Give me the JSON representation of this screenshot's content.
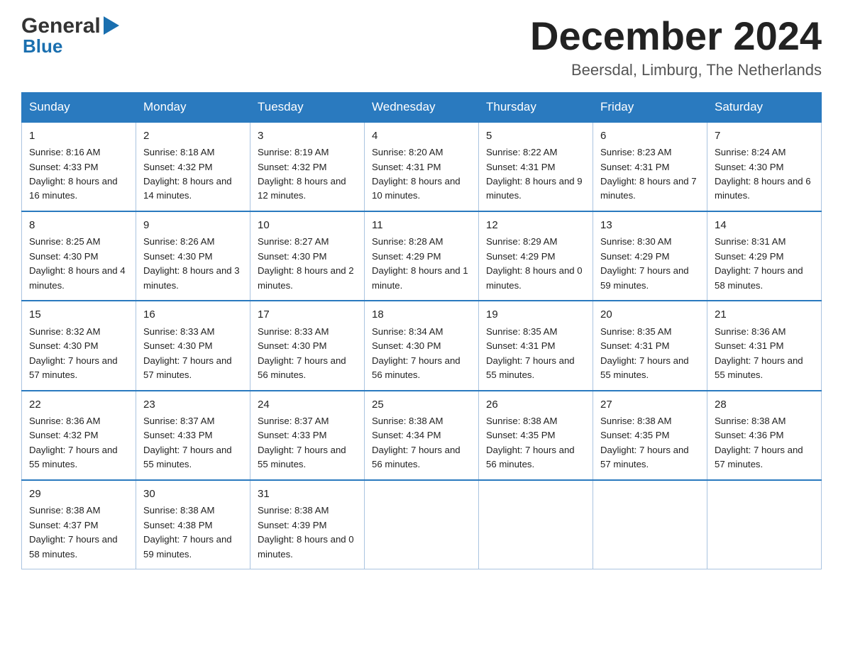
{
  "header": {
    "logo_general": "General",
    "logo_blue": "Blue",
    "month_title": "December 2024",
    "location": "Beersdal, Limburg, The Netherlands"
  },
  "days_of_week": [
    "Sunday",
    "Monday",
    "Tuesday",
    "Wednesday",
    "Thursday",
    "Friday",
    "Saturday"
  ],
  "weeks": [
    [
      {
        "day": "1",
        "sunrise": "8:16 AM",
        "sunset": "4:33 PM",
        "daylight": "8 hours and 16 minutes."
      },
      {
        "day": "2",
        "sunrise": "8:18 AM",
        "sunset": "4:32 PM",
        "daylight": "8 hours and 14 minutes."
      },
      {
        "day": "3",
        "sunrise": "8:19 AM",
        "sunset": "4:32 PM",
        "daylight": "8 hours and 12 minutes."
      },
      {
        "day": "4",
        "sunrise": "8:20 AM",
        "sunset": "4:31 PM",
        "daylight": "8 hours and 10 minutes."
      },
      {
        "day": "5",
        "sunrise": "8:22 AM",
        "sunset": "4:31 PM",
        "daylight": "8 hours and 9 minutes."
      },
      {
        "day": "6",
        "sunrise": "8:23 AM",
        "sunset": "4:31 PM",
        "daylight": "8 hours and 7 minutes."
      },
      {
        "day": "7",
        "sunrise": "8:24 AM",
        "sunset": "4:30 PM",
        "daylight": "8 hours and 6 minutes."
      }
    ],
    [
      {
        "day": "8",
        "sunrise": "8:25 AM",
        "sunset": "4:30 PM",
        "daylight": "8 hours and 4 minutes."
      },
      {
        "day": "9",
        "sunrise": "8:26 AM",
        "sunset": "4:30 PM",
        "daylight": "8 hours and 3 minutes."
      },
      {
        "day": "10",
        "sunrise": "8:27 AM",
        "sunset": "4:30 PM",
        "daylight": "8 hours and 2 minutes."
      },
      {
        "day": "11",
        "sunrise": "8:28 AM",
        "sunset": "4:29 PM",
        "daylight": "8 hours and 1 minute."
      },
      {
        "day": "12",
        "sunrise": "8:29 AM",
        "sunset": "4:29 PM",
        "daylight": "8 hours and 0 minutes."
      },
      {
        "day": "13",
        "sunrise": "8:30 AM",
        "sunset": "4:29 PM",
        "daylight": "7 hours and 59 minutes."
      },
      {
        "day": "14",
        "sunrise": "8:31 AM",
        "sunset": "4:29 PM",
        "daylight": "7 hours and 58 minutes."
      }
    ],
    [
      {
        "day": "15",
        "sunrise": "8:32 AM",
        "sunset": "4:30 PM",
        "daylight": "7 hours and 57 minutes."
      },
      {
        "day": "16",
        "sunrise": "8:33 AM",
        "sunset": "4:30 PM",
        "daylight": "7 hours and 57 minutes."
      },
      {
        "day": "17",
        "sunrise": "8:33 AM",
        "sunset": "4:30 PM",
        "daylight": "7 hours and 56 minutes."
      },
      {
        "day": "18",
        "sunrise": "8:34 AM",
        "sunset": "4:30 PM",
        "daylight": "7 hours and 56 minutes."
      },
      {
        "day": "19",
        "sunrise": "8:35 AM",
        "sunset": "4:31 PM",
        "daylight": "7 hours and 55 minutes."
      },
      {
        "day": "20",
        "sunrise": "8:35 AM",
        "sunset": "4:31 PM",
        "daylight": "7 hours and 55 minutes."
      },
      {
        "day": "21",
        "sunrise": "8:36 AM",
        "sunset": "4:31 PM",
        "daylight": "7 hours and 55 minutes."
      }
    ],
    [
      {
        "day": "22",
        "sunrise": "8:36 AM",
        "sunset": "4:32 PM",
        "daylight": "7 hours and 55 minutes."
      },
      {
        "day": "23",
        "sunrise": "8:37 AM",
        "sunset": "4:33 PM",
        "daylight": "7 hours and 55 minutes."
      },
      {
        "day": "24",
        "sunrise": "8:37 AM",
        "sunset": "4:33 PM",
        "daylight": "7 hours and 55 minutes."
      },
      {
        "day": "25",
        "sunrise": "8:38 AM",
        "sunset": "4:34 PM",
        "daylight": "7 hours and 56 minutes."
      },
      {
        "day": "26",
        "sunrise": "8:38 AM",
        "sunset": "4:35 PM",
        "daylight": "7 hours and 56 minutes."
      },
      {
        "day": "27",
        "sunrise": "8:38 AM",
        "sunset": "4:35 PM",
        "daylight": "7 hours and 57 minutes."
      },
      {
        "day": "28",
        "sunrise": "8:38 AM",
        "sunset": "4:36 PM",
        "daylight": "7 hours and 57 minutes."
      }
    ],
    [
      {
        "day": "29",
        "sunrise": "8:38 AM",
        "sunset": "4:37 PM",
        "daylight": "7 hours and 58 minutes."
      },
      {
        "day": "30",
        "sunrise": "8:38 AM",
        "sunset": "4:38 PM",
        "daylight": "7 hours and 59 minutes."
      },
      {
        "day": "31",
        "sunrise": "8:38 AM",
        "sunset": "4:39 PM",
        "daylight": "8 hours and 0 minutes."
      },
      null,
      null,
      null,
      null
    ]
  ],
  "labels": {
    "sunrise": "Sunrise:",
    "sunset": "Sunset:",
    "daylight": "Daylight:"
  },
  "colors": {
    "header_bg": "#2a7abf",
    "border": "#aac4e0",
    "header_border": "#2a7abf"
  }
}
